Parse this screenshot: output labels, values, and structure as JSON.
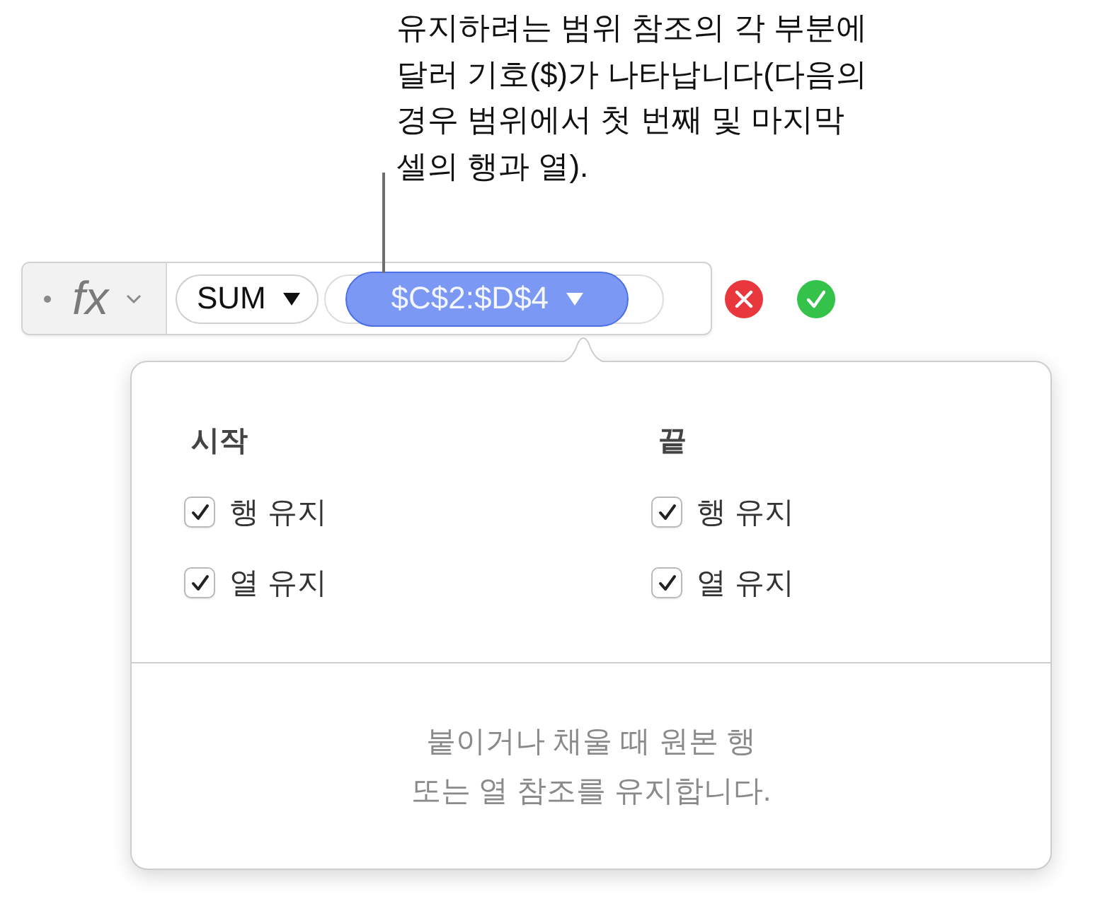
{
  "callout": {
    "text": "유지하려는 범위 참조의 각 부분에\n달러 기호($)가 나타납니다(다음의\n경우 범위에서 첫 번째 및 마지막\n셀의 행과 열)."
  },
  "formula_bar": {
    "label": "fx",
    "function": {
      "text": "SUM",
      "selected": false
    },
    "arguments": [
      {
        "text": "$C$2:$D$4",
        "selected": true
      }
    ],
    "buttons": [
      {
        "kind": "cancel"
      },
      {
        "kind": "accept"
      }
    ]
  },
  "popover": {
    "columns": [
      {
        "heading": "시작",
        "options": [
          {
            "label": "행 유지",
            "checked": true
          },
          {
            "label": "열 유지",
            "checked": true
          }
        ]
      },
      {
        "heading": "끝",
        "options": [
          {
            "label": "행 유지",
            "checked": true
          },
          {
            "label": "열 유지",
            "checked": true
          }
        ]
      }
    ],
    "note": "붙이거나 채울 때 원본 행\n또는 열 참조를 유지합니다."
  }
}
